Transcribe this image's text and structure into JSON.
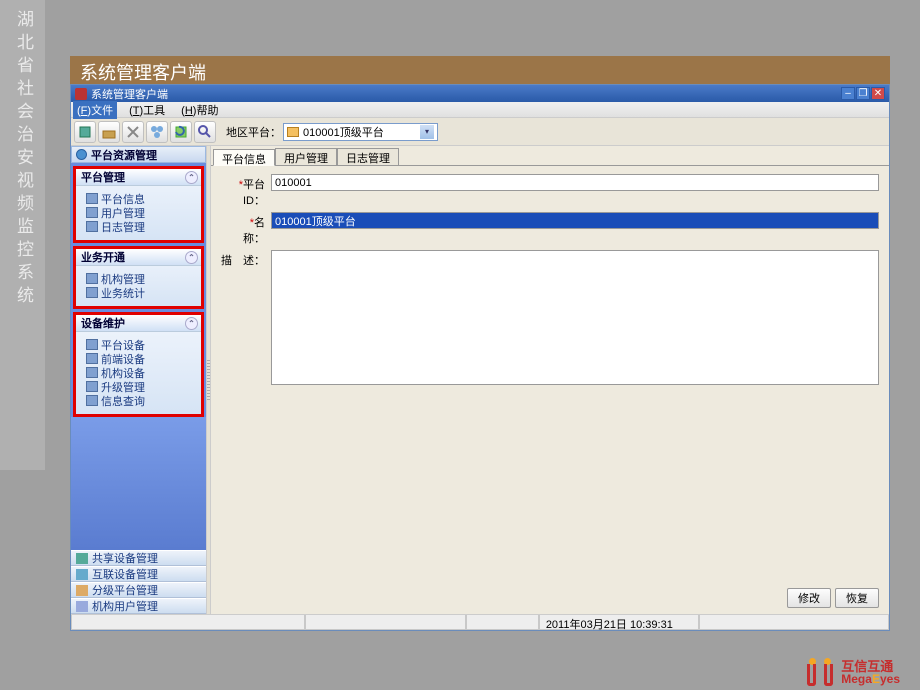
{
  "presentation": {
    "sidebar_title": "湖北省社会治安视频监控系统",
    "slide_title": "系统管理客户端"
  },
  "window": {
    "title": "系统管理客户端"
  },
  "menu": {
    "file": "文件",
    "tools": "工具",
    "help": "帮助"
  },
  "toolbar": {
    "reload": "reload",
    "region_label": "地区平台：",
    "region_value": "010001顶级平台"
  },
  "sidebar": {
    "resource_mgmt": "平台资源管理",
    "groups": [
      {
        "title": "平台管理",
        "items": [
          "平台信息",
          "用户管理",
          "日志管理"
        ]
      },
      {
        "title": "业务开通",
        "items": [
          "机构管理",
          "业务统计"
        ]
      },
      {
        "title": "设备维护",
        "items": [
          "平台设备",
          "前端设备",
          "机构设备",
          "升级管理",
          "信息查询"
        ]
      }
    ],
    "bottom": [
      "共享设备管理",
      "互联设备管理",
      "分级平台管理",
      "机构用户管理"
    ]
  },
  "tabs": [
    "平台信息",
    "用户管理",
    "日志管理"
  ],
  "form": {
    "id_label": "平台 ID：",
    "id_value": "010001",
    "name_label": "名　称：",
    "name_value": "010001顶级平台",
    "desc_label": "描　述：",
    "desc_value": ""
  },
  "buttons": {
    "modify": "修改",
    "restore": "恢复"
  },
  "status": {
    "datetime": "2011年03月21日 10:39:31"
  },
  "footer": {
    "brand_cn": "互信互通",
    "brand_en_pre": "Mega",
    "brand_en_e": "E",
    "brand_en_post": "yes"
  }
}
